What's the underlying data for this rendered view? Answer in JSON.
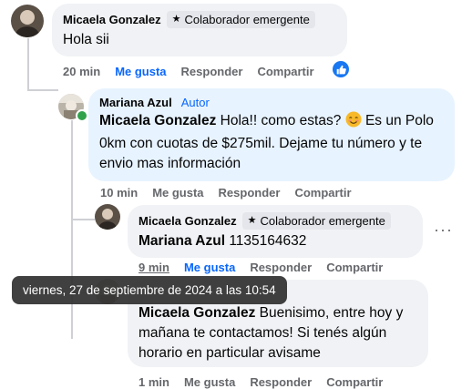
{
  "comments": [
    {
      "author": "Micaela Gonzalez",
      "badge": "Colaborador emergente",
      "text": "Hola sii",
      "time": "20 min",
      "like_label": "Me gusta",
      "reply_label": "Responder",
      "share_label": "Compartir"
    },
    {
      "author": "Mariana Azul",
      "author_tag": "Autor",
      "mention": "Micaela Gonzalez",
      "text_before_emoji": " Hola!! como estas? ",
      "text_after_emoji": " Es un Polo 0km con cuotas de $275mil. Dejame tu número y te envio mas información",
      "time": "10 min",
      "like_label": "Me gusta",
      "reply_label": "Responder",
      "share_label": "Compartir"
    },
    {
      "author": "Micaela Gonzalez",
      "badge": "Colaborador emergente",
      "mention": "Mariana Azul",
      "text": " 1135164632",
      "time": "9 min",
      "like_label": "Me gusta",
      "reply_label": "Responder",
      "share_label": "Compartir"
    },
    {
      "mention": "Micaela Gonzalez",
      "text": " Buenisimo, entre hoy y mañana te contactamos! Si tenés algún horario en particular avisame",
      "time": "1 min",
      "like_label": "Me gusta",
      "reply_label": "Responder",
      "share_label": "Compartir"
    }
  ],
  "tooltip": "viernes, 27 de septiembre de 2024 a las 10:54",
  "colors": {
    "link_blue": "#0866ff",
    "bubble_grey": "#f0f2f5",
    "bubble_blue": "#e7f3ff",
    "meta_grey": "#65676b"
  },
  "icons": {
    "badge": "star-icon",
    "reaction": "like-icon",
    "menu": "more-options-icon",
    "emoji": "smiling-face-emoji"
  }
}
